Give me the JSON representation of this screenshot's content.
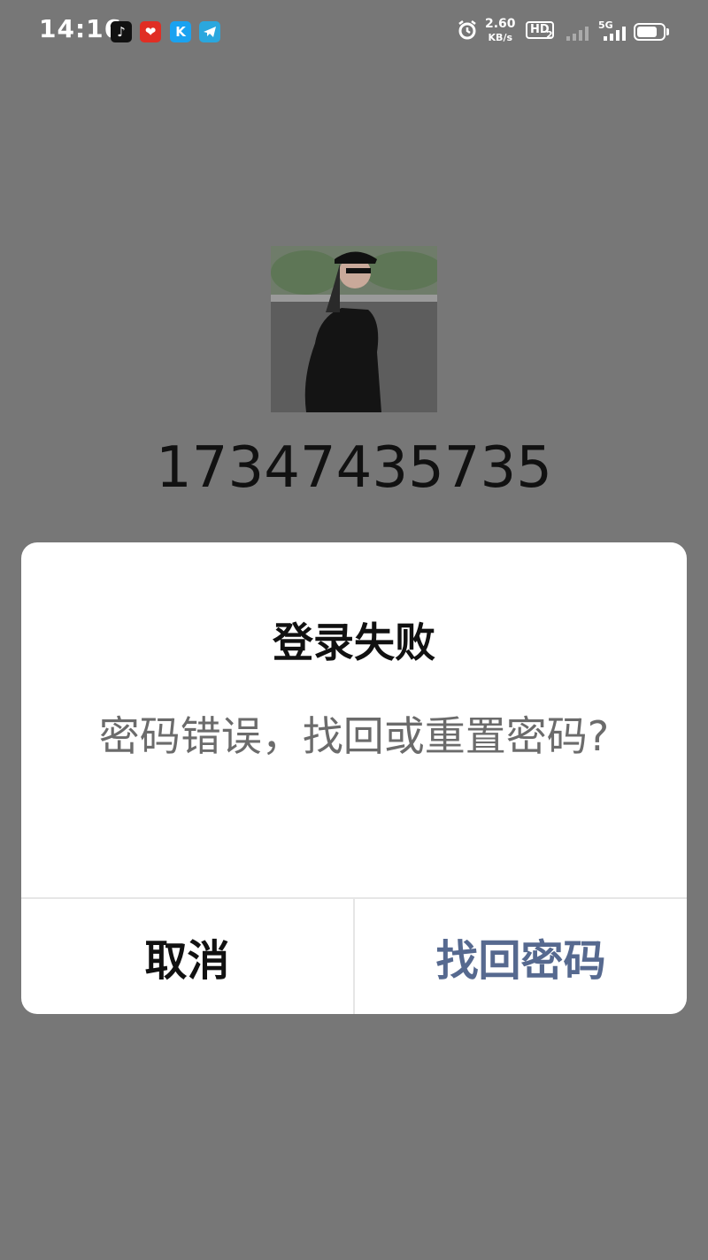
{
  "status_bar": {
    "time": "14:16",
    "net_speed_value": "2.60",
    "net_speed_unit": "KB/s",
    "hd_label": "HD",
    "hd_sub": "2",
    "network_type": "5G",
    "app_icons": [
      "tiktok-icon",
      "pinduoduo-icon",
      "k-app-icon",
      "telegram-icon"
    ]
  },
  "profile": {
    "phone_number": "17347435735"
  },
  "dialog": {
    "title": "登录失败",
    "message": "密码错误，找回或重置密码?",
    "cancel_label": "取消",
    "recover_label": "找回密码"
  },
  "colors": {
    "background": "#777777",
    "dialog_bg": "#ffffff",
    "accent_button": "#56698f",
    "message_text": "#6b6b6b"
  }
}
